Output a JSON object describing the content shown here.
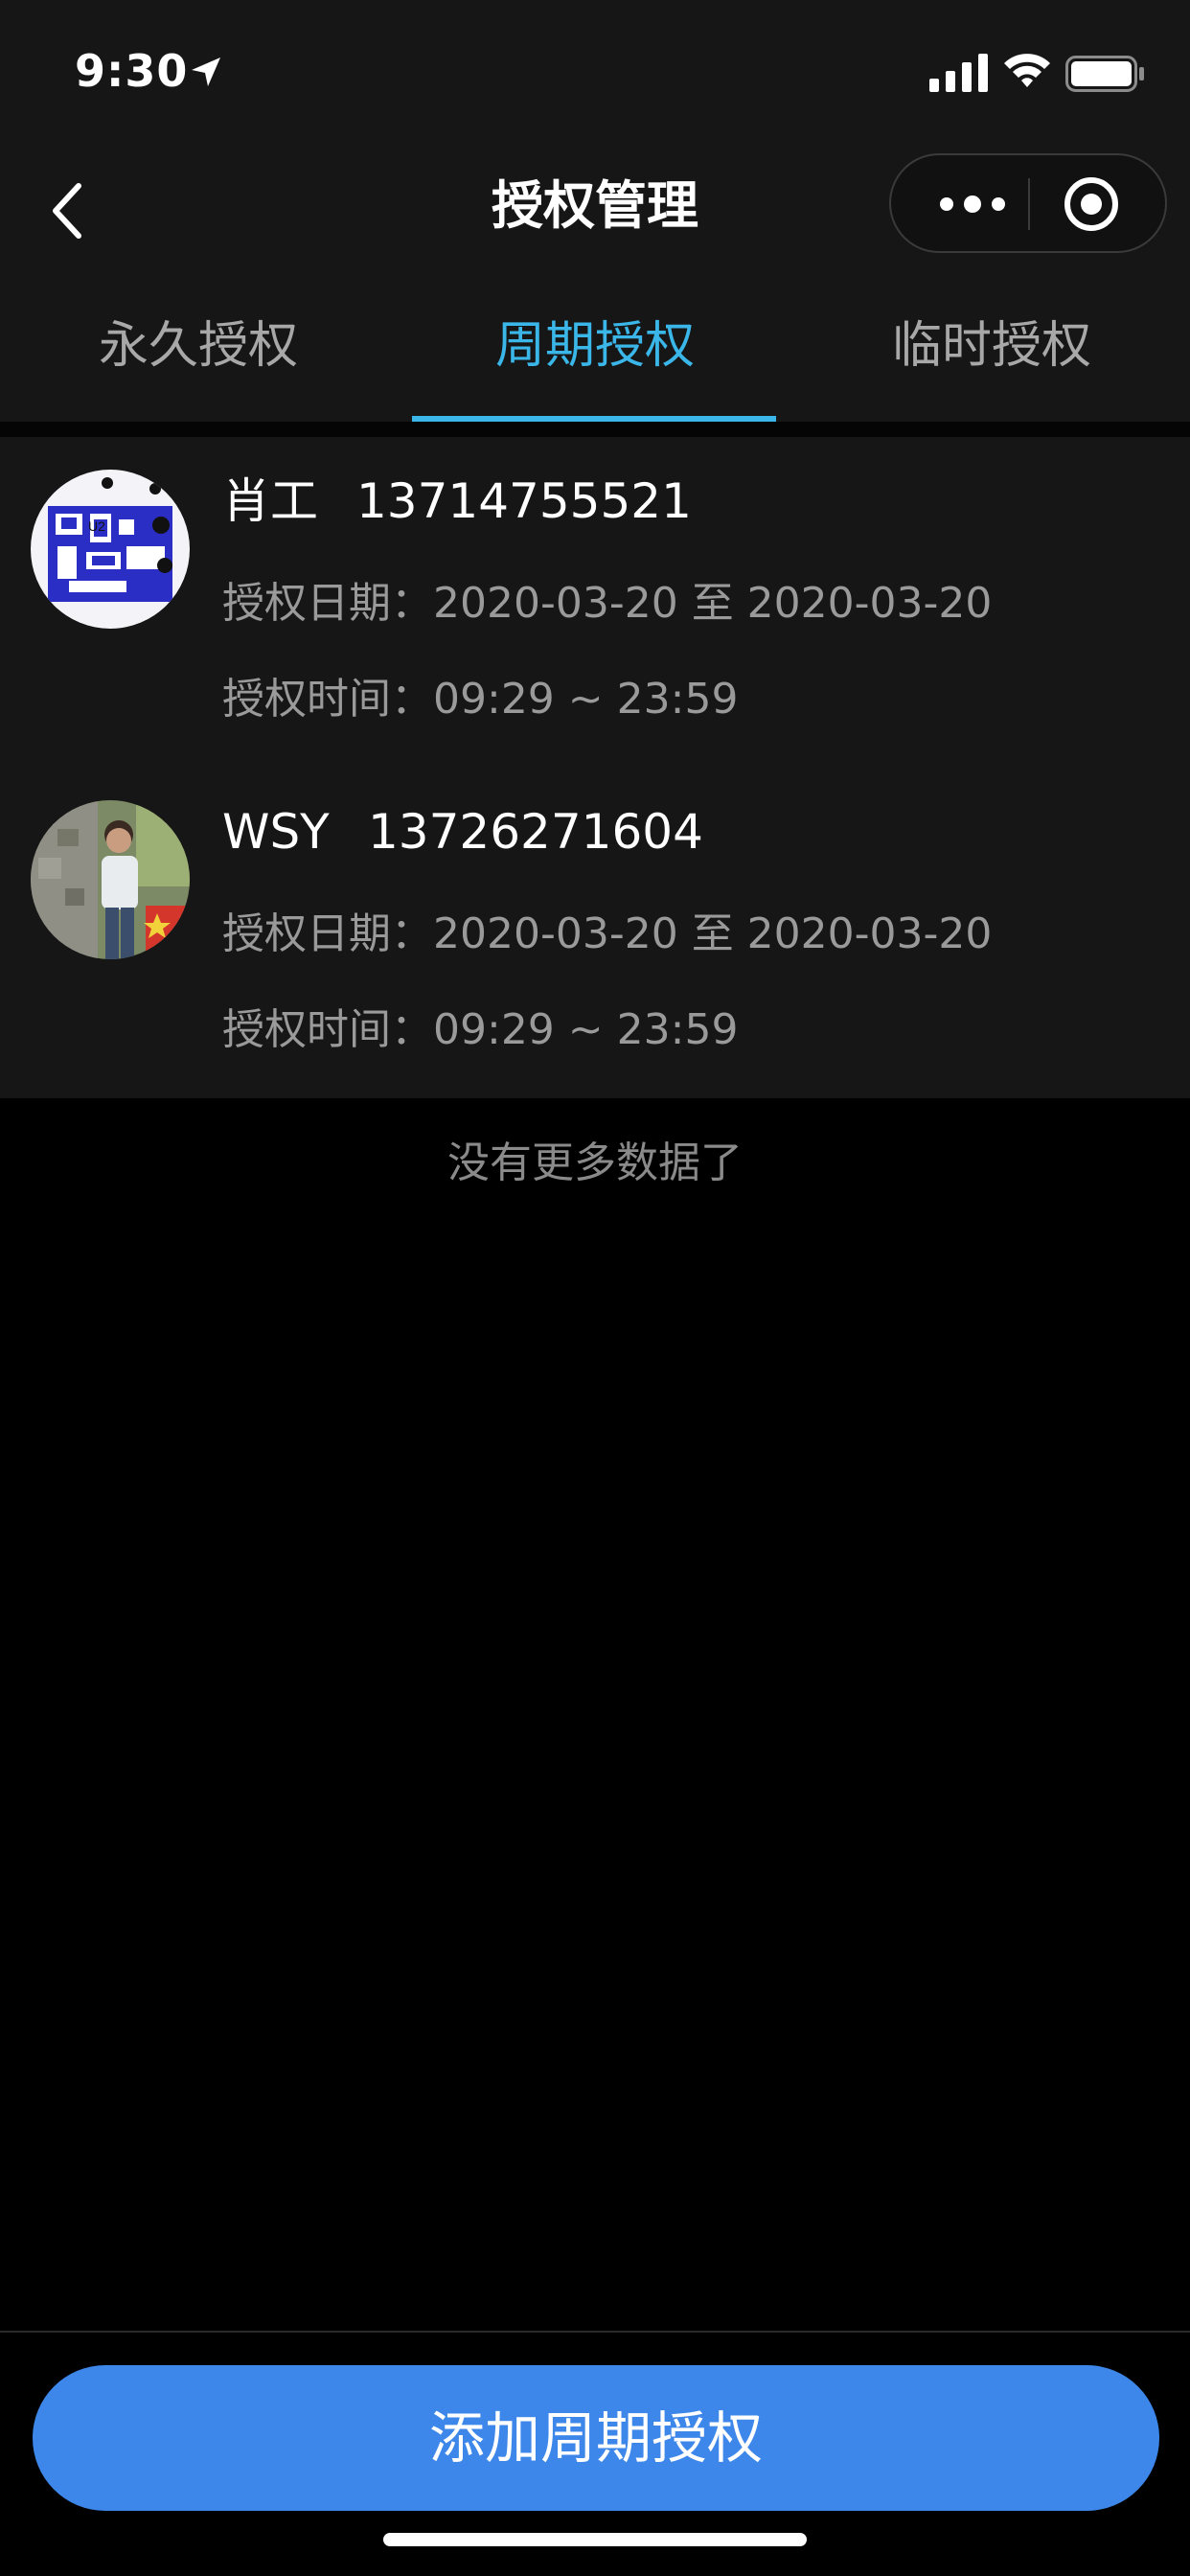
{
  "status_bar": {
    "time": "9:30",
    "location_icon": "location-arrow-icon",
    "signal_icon": "cellular-signal-icon",
    "wifi_icon": "wifi-icon",
    "battery_icon": "battery-icon"
  },
  "nav": {
    "back_icon": "chevron-left-icon",
    "title": "授权管理",
    "more_icon": "more-dots-icon",
    "close_icon": "target-circle-icon"
  },
  "tabs": [
    {
      "label": "永久授权",
      "active": false
    },
    {
      "label": "周期授权",
      "active": true
    },
    {
      "label": "临时授权",
      "active": false
    }
  ],
  "list": {
    "items": [
      {
        "name": "肖工",
        "phone": "13714755521",
        "date_label": "授权日期：",
        "date_range": "2020-03-20 至 2020-03-20",
        "time_label": "授权时间：",
        "time_range": "09:29 ~ 23:59",
        "avatar": "circuit-board-avatar"
      },
      {
        "name": "WSY",
        "phone": "13726271604",
        "date_label": "授权日期：",
        "date_range": "2020-03-20 至 2020-03-20",
        "time_label": "授权时间：",
        "time_range": "09:29 ~ 23:59",
        "avatar": "person-photo-avatar"
      }
    ],
    "no_more": "没有更多数据了"
  },
  "footer": {
    "add_button": "添加周期授权"
  },
  "colors": {
    "accent": "#3bb6e8",
    "button": "#3d87ea",
    "background": "#000000",
    "panel": "#161616"
  }
}
